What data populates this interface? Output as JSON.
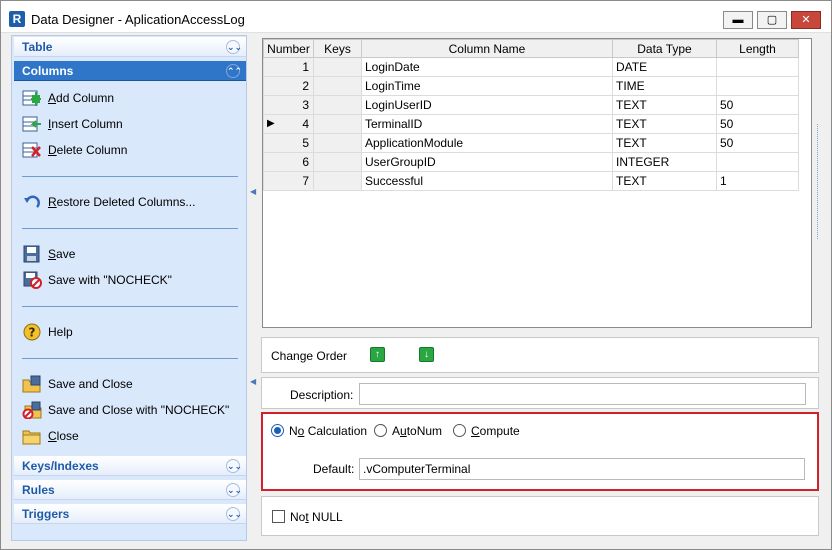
{
  "window": {
    "title": "Data Designer - AplicationAccessLog",
    "minimize": "▬",
    "maximize": "▢",
    "close": "✕"
  },
  "sidebar": {
    "table_header": "Table",
    "columns_header": "Columns",
    "keys_header": "Keys/Indexes",
    "rules_header": "Rules",
    "triggers_header": "Triggers",
    "chevron_down": "⌄⌄",
    "chevron_up": "⌃⌃",
    "actions": {
      "add_column": {
        "hot": "A",
        "rest": "dd Column"
      },
      "insert_column": {
        "hot": "I",
        "rest": "nsert Column"
      },
      "delete_column": {
        "hot": "D",
        "rest": "elete Column"
      },
      "restore": {
        "hot": "R",
        "rest": "estore Deleted Columns..."
      },
      "save": {
        "hot": "S",
        "rest": "ave"
      },
      "save_nocheck": {
        "hot": "",
        "rest": "Save with \"NOCHECK\""
      },
      "help": {
        "hot": "",
        "rest": "Help"
      },
      "save_close": {
        "hot": "",
        "rest": "Save and Close"
      },
      "save_close_nocheck": {
        "hot": "",
        "rest": "Save and Close with \"NOCHECK\""
      },
      "close": {
        "hot": "C",
        "rest": "lose"
      }
    }
  },
  "grid": {
    "headers": [
      "Number",
      "Keys",
      "Column Name",
      "Data Type",
      "Length"
    ],
    "current_row_marker": "▶",
    "rows": [
      {
        "number": "1",
        "keys": "",
        "name": "LoginDate",
        "type": "DATE",
        "length": ""
      },
      {
        "number": "2",
        "keys": "",
        "name": "LoginTime",
        "type": "TIME",
        "length": ""
      },
      {
        "number": "3",
        "keys": "",
        "name": "LoginUserID",
        "type": "TEXT",
        "length": "50"
      },
      {
        "number": "4",
        "keys": "",
        "name": "TerminalID",
        "type": "TEXT",
        "length": "50"
      },
      {
        "number": "5",
        "keys": "",
        "name": "ApplicationModule",
        "type": "TEXT",
        "length": "50"
      },
      {
        "number": "6",
        "keys": "",
        "name": "UserGroupID",
        "type": "INTEGER",
        "length": ""
      },
      {
        "number": "7",
        "keys": "",
        "name": "Successful",
        "type": "TEXT",
        "length": "1"
      }
    ],
    "selected_row": 4
  },
  "order": {
    "label": "Change Order",
    "up": "↑",
    "down": "↓"
  },
  "details": {
    "description_label": "Description:",
    "description_value": "",
    "radios": [
      {
        "hot_pre": "N",
        "hot": "o",
        "rest": " Calculation",
        "checked": true
      },
      {
        "hot_pre": "A",
        "hot": "u",
        "rest": "toNum",
        "checked": false
      },
      {
        "hot_pre": "",
        "hot": "C",
        "rest": "ompute",
        "checked": false
      }
    ],
    "default_label": "Default:",
    "default_value": ".vComputerTerminal",
    "not_null_pre": "No",
    "not_null_hot": "t",
    "not_null_rest": " NULL",
    "not_null_checked": false
  },
  "colors": {
    "accent": "#2f75c8",
    "panel_bg": "#d9e8fb",
    "highlight_border": "#d0202a",
    "arrow_green": "#2aa642"
  }
}
